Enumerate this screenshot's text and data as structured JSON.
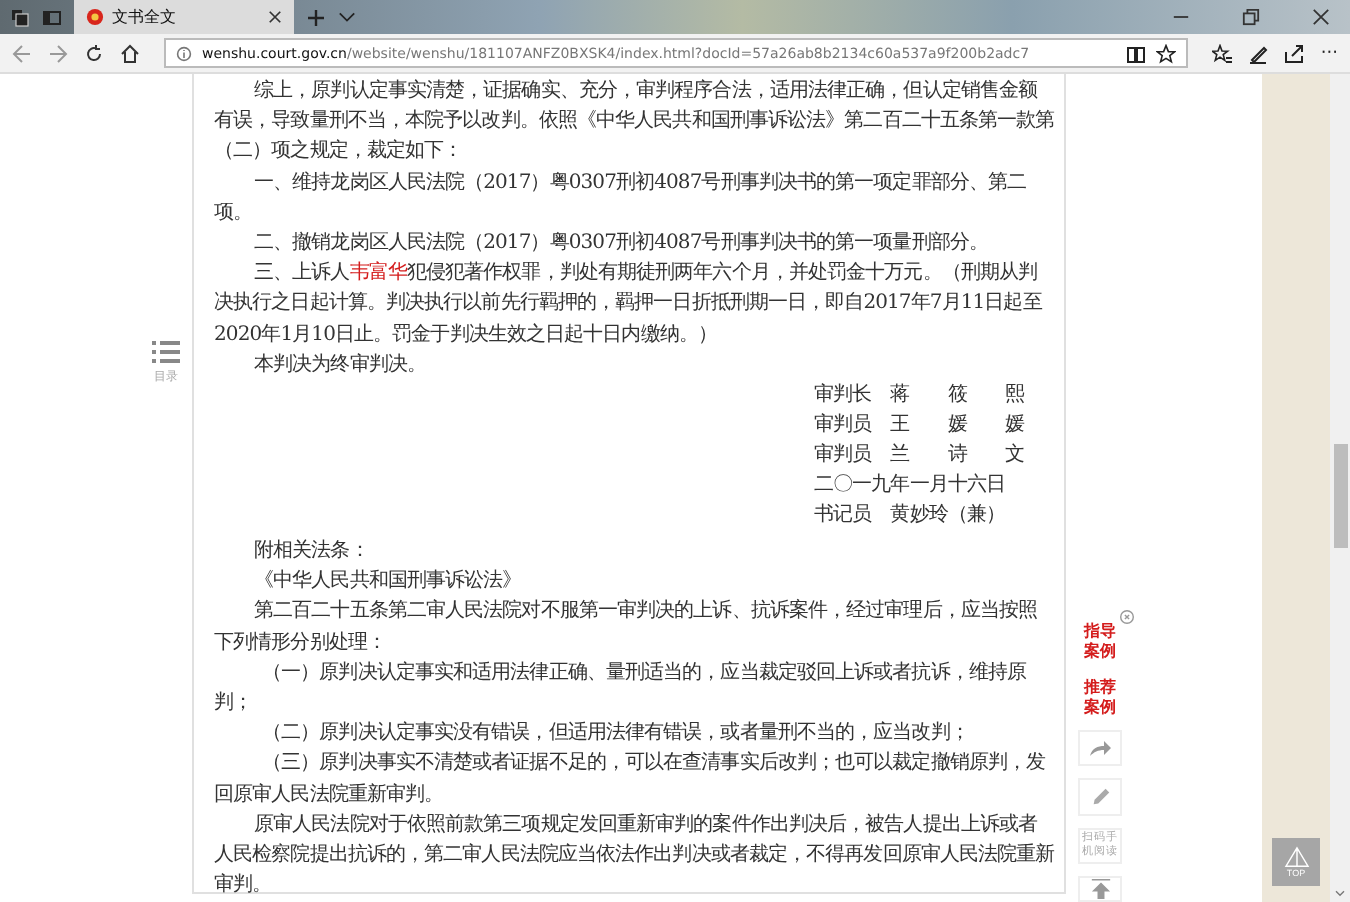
{
  "browser": {
    "tab_title": "文书全文",
    "url_host": "wenshu.court.gov.cn",
    "url_path": "/website/wenshu/181107ANFZ0BXSK4/index.html?docId=57a26ab8b2134c60a537a9f200b2adc7",
    "more": "···"
  },
  "toc": {
    "label": "目录"
  },
  "document": {
    "paragraphs": [
      {
        "kind": "plain",
        "text": "综上，原判认定事实清楚，证据确实、充分，审判程序合法，适用法律正确，但认定销售金额有误，导致量刑不当，本院予以改判。依照《中华人民共和国刑事诉讼法》第二百二十五条第一款第（二）项之规定，裁定如下："
      },
      {
        "kind": "plain",
        "text": "一、维持龙岗区人民法院（2017）粤0307刑初4087号刑事判决书的第一项定罪部分、第二项。"
      },
      {
        "kind": "plain",
        "text": "二、撤销龙岗区人民法院（2017）粤0307刑初4087号刑事判决书的第一项量刑部分。"
      },
      {
        "kind": "party",
        "before": "三、上诉人",
        "name": "韦富华",
        "after": "犯侵犯著作权罪，判处有期徒刑两年六个月，并处罚金十万元。（刑期从判决执行之日起计算。判决执行以前先行羁押的，羁押一日折抵刑期一日，即自2017年7月11日起至2020年1月10日止。罚金于判决生效之日起十日内缴纳。）"
      },
      {
        "kind": "plain",
        "text": "本判决为终审判决。"
      }
    ],
    "signatures": [
      "审判长　蒋　　筱　　熙",
      "审判员　王　　媛　　媛",
      "审判员　兰　　诗　　文",
      "二〇一九年一月十六日",
      "书记员　黄妙玲（兼）"
    ],
    "appendix": [
      {
        "kind": "plain",
        "text": "附相关法条："
      },
      {
        "kind": "plain",
        "text": "《中华人民共和国刑事诉讼法》"
      },
      {
        "kind": "plain",
        "text": "第二百二十五条第二审人民法院对不服第一审判决的上诉、抗诉案件，经过审理后，应当按照下列情形分别处理："
      },
      {
        "kind": "item",
        "text": "（一）原判决认定事实和适用法律正确、量刑适当的，应当裁定驳回上诉或者抗诉，维持原判；"
      },
      {
        "kind": "item",
        "text": "（二）原判决认定事实没有错误，但适用法律有错误，或者量刑不当的，应当改判；"
      },
      {
        "kind": "item",
        "text": "（三）原判决事实不清楚或者证据不足的，可以在查清事实后改判；也可以裁定撤销原判，发回原审人民法院重新审判。"
      },
      {
        "kind": "plain",
        "text": "原审人民法院对于依照前款第三项规定发回重新审判的案件作出判决后，被告人提出上诉或者人民检察院提出抗诉的，第二审人民法院应当依法作出判决或者裁定，不得再发回原审人民法院重新审判。"
      }
    ]
  },
  "tools": {
    "links": [
      "指导案例",
      "推荐案例"
    ],
    "qr_label": "扫码手机阅读"
  },
  "top_button": {
    "label": "TOP"
  }
}
